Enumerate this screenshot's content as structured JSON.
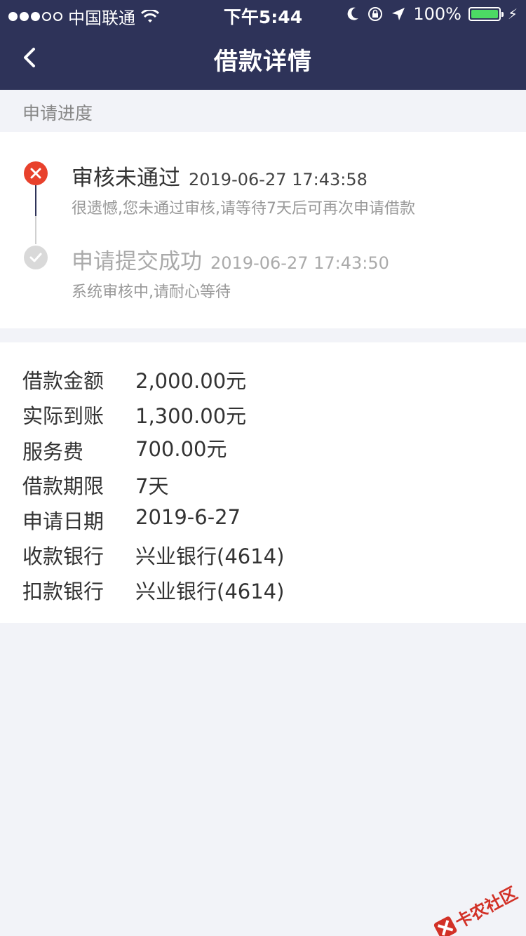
{
  "status_bar": {
    "carrier": "中国联通",
    "time": "下午5:44",
    "battery": "100%"
  },
  "nav": {
    "title": "借款详情"
  },
  "progress": {
    "label": "申请进度",
    "steps": [
      {
        "title": "审核未通过",
        "time": "2019-06-27 17:43:58",
        "desc": "很遗憾,您未通过审核,请等待7天后可再次申请借款",
        "status": "fail"
      },
      {
        "title": "申请提交成功",
        "time": "2019-06-27 17:43:50",
        "desc": "系统审核中,请耐心等待",
        "status": "done"
      }
    ]
  },
  "details": {
    "rows": [
      {
        "label": "借款金额",
        "value": "2,000.00元"
      },
      {
        "label": "实际到账",
        "value": "1,300.00元"
      },
      {
        "label": "服务费",
        "value": "700.00元"
      },
      {
        "label": "借款期限",
        "value": "7天"
      },
      {
        "label": "申请日期",
        "value": "2019-6-27"
      },
      {
        "label": "收款银行",
        "value": "兴业银行(4614)"
      },
      {
        "label": "扣款银行",
        "value": "兴业银行(4614)"
      }
    ]
  },
  "watermark": {
    "text": "卡农社区"
  },
  "colors": {
    "header_bg": "#2e3359",
    "fail": "#e8412c",
    "success_icon": "#d9d9d9",
    "page_bg": "#f2f3f8"
  }
}
